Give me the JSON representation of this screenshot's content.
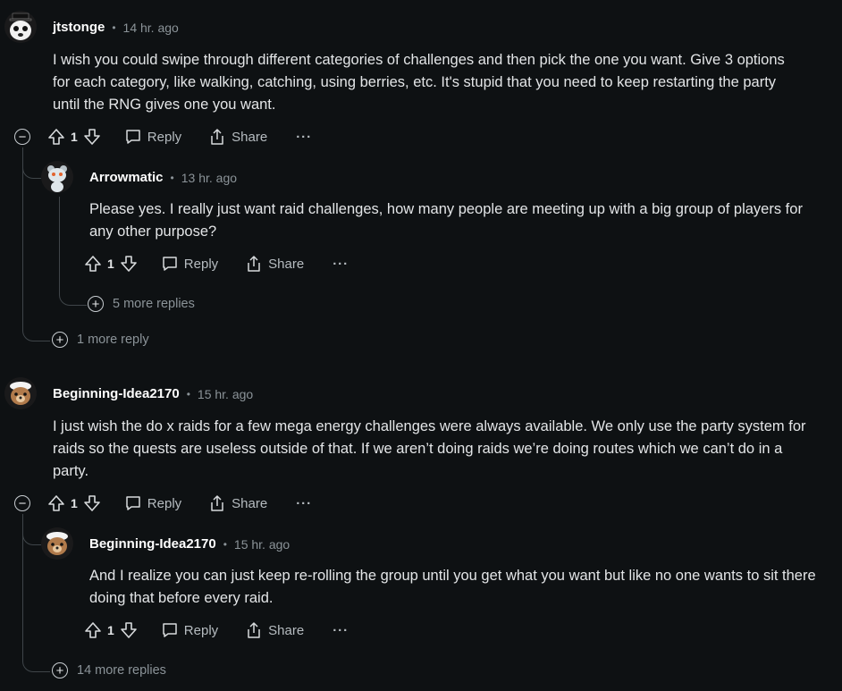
{
  "comments": [
    {
      "user": "jtstonge",
      "time": "14 hr. ago",
      "body": "I wish you could swipe through different categories of challenges and then pick the one you want. Give 3 options for each category, like walking, catching, using berries, etc. It's stupid that you need to keep restarting the party until the RNG gives one you want.",
      "votes": "1",
      "reply_label": "Reply",
      "share_label": "Share",
      "more_label": "···",
      "collapse_icon": "minus-circle-icon",
      "avatar_icon": "panda-avatar-icon",
      "reply": {
        "user": "Arrowmatic",
        "time": "13 hr. ago",
        "body": "Please yes. I really just want raid challenges, how many people are meeting up with a big group of players for any other purpose?",
        "votes": "1",
        "reply_label": "Reply",
        "share_label": "Share",
        "more_label": "···",
        "avatar_icon": "snoo-avatar-icon",
        "more_replies": "5 more replies"
      },
      "more_replies": "1 more reply"
    },
    {
      "user": "Beginning-Idea2170",
      "time": "15 hr. ago",
      "body": "I just wish the do x raids for a few mega energy challenges were always available. We only use the party system for raids so the quests are useless outside of that. If we aren’t doing raids we’re doing routes which we can’t do in a party.",
      "votes": "1",
      "reply_label": "Reply",
      "share_label": "Share",
      "more_label": "···",
      "collapse_icon": "minus-circle-icon",
      "avatar_icon": "bear-avatar-icon",
      "reply": {
        "user": "Beginning-Idea2170",
        "time": "15 hr. ago",
        "body": "And I realize you can just keep re-rolling the group until you get what you want but like no one wants to sit there doing that before every raid.",
        "votes": "1",
        "reply_label": "Reply",
        "share_label": "Share",
        "more_label": "···",
        "avatar_icon": "bear-avatar-icon"
      },
      "more_replies": "14 more replies"
    }
  ],
  "separator_dot": "•"
}
